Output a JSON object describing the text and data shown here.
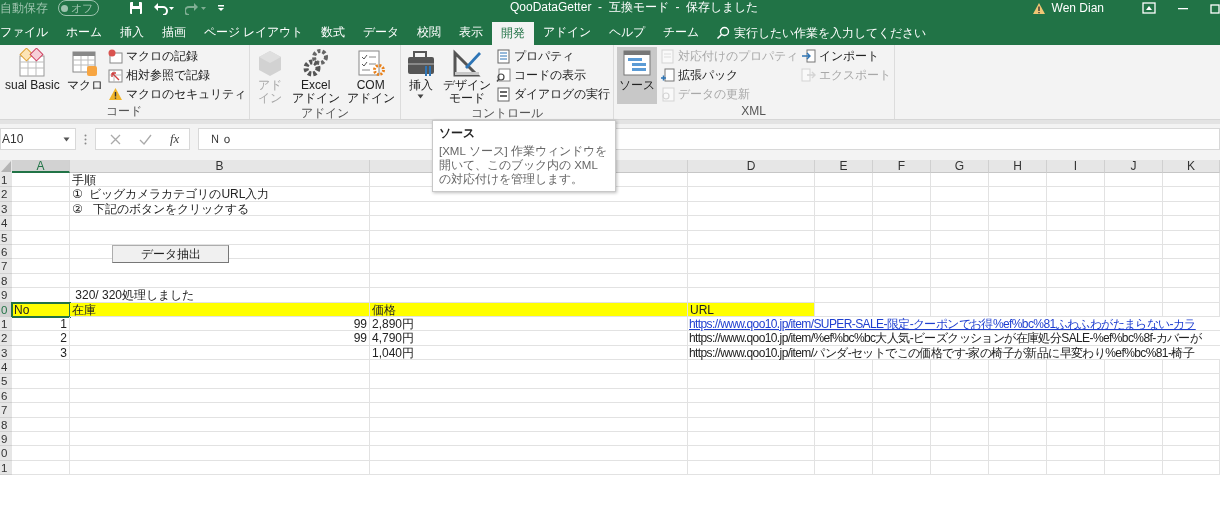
{
  "title_bar": {
    "autosave_label": "自動保存",
    "autosave_toggle": {
      "text": "オフ",
      "on": false
    },
    "title": "QooDataGetter  -  互換モード  -  保存しました",
    "user": "Wen Dian"
  },
  "tabs": [
    {
      "label": "ファイル",
      "selected": false
    },
    {
      "label": "ホーム",
      "selected": false
    },
    {
      "label": "挿入",
      "selected": false
    },
    {
      "label": "描画",
      "selected": false
    },
    {
      "label": "ページ レイアウト",
      "selected": false
    },
    {
      "label": "数式",
      "selected": false
    },
    {
      "label": "データ",
      "selected": false
    },
    {
      "label": "校閲",
      "selected": false
    },
    {
      "label": "表示",
      "selected": false
    },
    {
      "label": "開発",
      "selected": true
    },
    {
      "label": "アドイン",
      "selected": false
    },
    {
      "label": "ヘルプ",
      "selected": false
    },
    {
      "label": "チーム",
      "selected": false
    }
  ],
  "search": {
    "placeholder": "実行したい作業を入力してください"
  },
  "ribbon": {
    "groups": [
      {
        "label": "コード",
        "columns": [
          {
            "kind": "large",
            "lines": [
              "sual Basic"
            ],
            "disabled": false,
            "hovered": false
          },
          {
            "kind": "large",
            "lines": [
              "マクロ"
            ],
            "disabled": false,
            "hovered": false
          },
          {
            "kind": "stack",
            "items": [
              {
                "label": "マクロの記録",
                "disabled": false
              },
              {
                "label": "相対参照で記録",
                "disabled": false
              },
              {
                "label": "マクロのセキュリティ",
                "disabled": false
              }
            ]
          }
        ]
      },
      {
        "label": "アドイン",
        "columns": [
          {
            "kind": "large",
            "lines": [
              "アド",
              "イン"
            ],
            "disabled": true,
            "hovered": false
          },
          {
            "kind": "large",
            "lines": [
              "Excel",
              "アドイン"
            ],
            "disabled": false,
            "hovered": false
          },
          {
            "kind": "large",
            "lines": [
              "COM",
              "アドイン"
            ],
            "disabled": false,
            "hovered": false
          }
        ]
      },
      {
        "label": "コントロール",
        "columns": [
          {
            "kind": "large",
            "lines": [
              "挿入"
            ],
            "dropdown": true,
            "disabled": false,
            "hovered": false
          },
          {
            "kind": "large",
            "lines": [
              "デザイン",
              "モード"
            ],
            "disabled": false,
            "hovered": false
          },
          {
            "kind": "stack",
            "items": [
              {
                "label": "プロパティ",
                "disabled": false
              },
              {
                "label": "コードの表示",
                "disabled": false
              },
              {
                "label": "ダイアログの実行",
                "disabled": false
              }
            ]
          }
        ]
      },
      {
        "label": "XML",
        "columns": [
          {
            "kind": "large",
            "lines": [
              "ソース"
            ],
            "disabled": false,
            "hovered": true
          },
          {
            "kind": "stack",
            "items": [
              {
                "label": "対応付けのプロパティ",
                "disabled": true
              },
              {
                "label": "拡張パック",
                "disabled": false
              },
              {
                "label": "データの更新",
                "disabled": true
              }
            ]
          },
          {
            "kind": "stack",
            "items": [
              {
                "label": "インポート",
                "disabled": false
              },
              {
                "label": "エクスポート",
                "disabled": true
              }
            ]
          }
        ]
      }
    ]
  },
  "formula_bar": {
    "name_box": "A10",
    "function_label": "fx",
    "value": "Ｎｏ"
  },
  "tooltip": {
    "title": "ソース",
    "text": "[XML ソース] 作業ウィンドウを開いて、このブック内の XML の対応付けを管理します。"
  },
  "sheet": {
    "columns": [
      {
        "kind": "label",
        "label": "A",
        "selected": true
      },
      {
        "kind": "label",
        "label": "B",
        "selected": false
      },
      {
        "kind": "blank"
      },
      {
        "kind": "label",
        "label": "D",
        "selected": false
      },
      {
        "kind": "label",
        "label": "E",
        "selected": false
      },
      {
        "kind": "label",
        "label": "F",
        "selected": false
      },
      {
        "kind": "label",
        "label": "G",
        "selected": false
      },
      {
        "kind": "label",
        "label": "H",
        "selected": false
      },
      {
        "kind": "label",
        "label": "I",
        "selected": false
      },
      {
        "kind": "label",
        "label": "J",
        "selected": false
      },
      {
        "kind": "label",
        "label": "K",
        "selected": false
      }
    ],
    "rows": [
      {
        "header": "1",
        "selected": false,
        "cells": {
          "B": {
            "text": "手順",
            "kind": "text",
            "selected": false
          }
        }
      },
      {
        "header": "2",
        "selected": false,
        "cells": {
          "B": {
            "text": "①  ビッグカメラカテゴリのURL入力",
            "kind": "text",
            "selected": false
          }
        }
      },
      {
        "header": "3",
        "selected": false,
        "cells": {
          "B": {
            "text": "②   下記のボタンをクリックする",
            "kind": "text",
            "selected": false
          }
        }
      },
      {
        "header": "4",
        "selected": false
      },
      {
        "header": "5",
        "selected": false
      },
      {
        "header": "6",
        "selected": false
      },
      {
        "header": "7",
        "selected": false
      },
      {
        "header": "8",
        "selected": false
      },
      {
        "header": "9",
        "selected": false,
        "cells": {
          "B": {
            "text": " 320/ 320処理しました",
            "kind": "text",
            "selected": false
          }
        }
      },
      {
        "header": "0",
        "selected": true,
        "cells": {
          "A": {
            "text": "No",
            "kind": "text",
            "selected": true,
            "color": "#ffff00"
          },
          "B": {
            "text": "在庫",
            "kind": "text",
            "selected": false,
            "color": "#ffff00"
          },
          "C": {
            "text": "価格",
            "kind": "text",
            "selected": false,
            "color": "#ffff00"
          },
          "D": {
            "text": "URL",
            "kind": "text",
            "selected": false,
            "color": "#ffff00"
          }
        }
      },
      {
        "header": "1",
        "selected": false,
        "cells": {
          "A": {
            "text": "1",
            "kind": "number",
            "selected": false
          },
          "B": {
            "text": "99",
            "kind": "number",
            "selected": false
          },
          "C": {
            "text": "2,890円",
            "kind": "text",
            "selected": false
          },
          "D": {
            "text": "https://www.qoo10.jp/item/SUPER-SALE-限定-クーポンでお得%ef%bc%81ふわふわがたまらない-カラ",
            "kind": "url",
            "link": true,
            "selected": false
          }
        }
      },
      {
        "header": "2",
        "selected": false,
        "cells": {
          "A": {
            "text": "2",
            "kind": "number",
            "selected": false
          },
          "B": {
            "text": "99",
            "kind": "number",
            "selected": false
          },
          "C": {
            "text": "4,790円",
            "kind": "text",
            "selected": false
          },
          "D": {
            "text": "https://www.qoo10.jp/item/%ef%bc%bc大人気-ビーズクッションが在庫処分SALE-%ef%bc%8f-カバーが",
            "kind": "url",
            "link": false,
            "selected": false
          }
        }
      },
      {
        "header": "3",
        "selected": false,
        "cells": {
          "A": {
            "text": "3",
            "kind": "number",
            "selected": false
          },
          "C": {
            "text": "1,040円",
            "kind": "text",
            "selected": false
          },
          "D": {
            "text": "https://www.qoo10.jp/item/パンダ-セットでこの価格です-家の椅子が新品に早変わり%ef%bc%81-椅子",
            "kind": "url",
            "link": false,
            "selected": false
          }
        }
      },
      {
        "header": "4",
        "selected": false
      },
      {
        "header": "5",
        "selected": false
      },
      {
        "header": "6",
        "selected": false
      },
      {
        "header": "7",
        "selected": false
      },
      {
        "header": "8",
        "selected": false
      },
      {
        "header": "9",
        "selected": false
      },
      {
        "header": "0",
        "selected": false
      },
      {
        "header": "1",
        "selected": false
      }
    ],
    "button": {
      "label": "データ抽出"
    }
  }
}
